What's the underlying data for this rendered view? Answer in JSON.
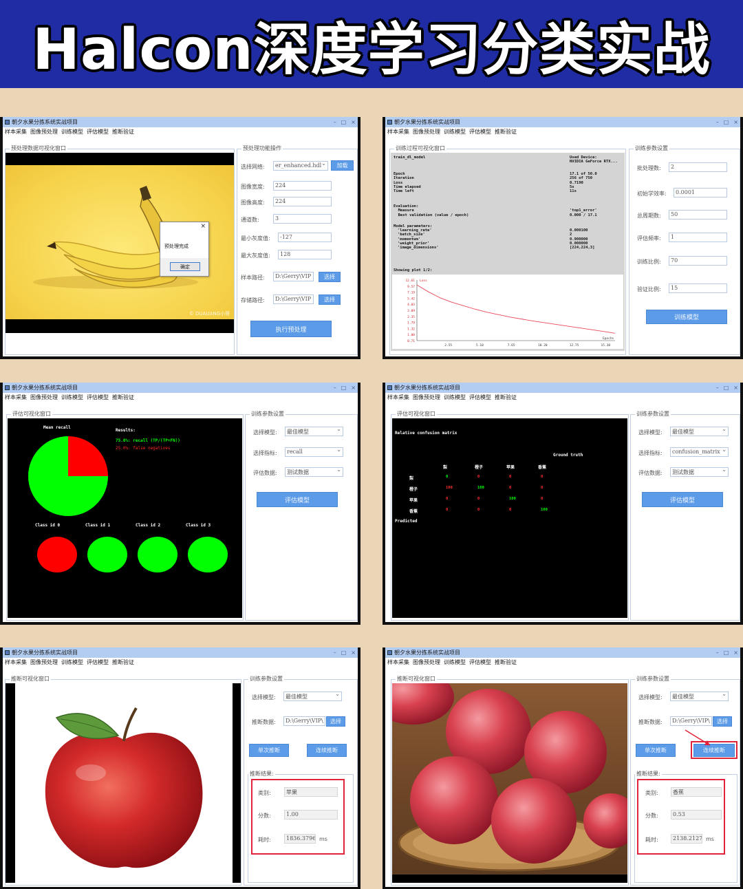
{
  "banner_title": "Halcon深度学习分类实战",
  "window": {
    "title": "朝夕水果分拣系统实战项目",
    "menu": [
      "样本采集",
      "图像预处理",
      "训练模型",
      "评估模型",
      "推断验证"
    ],
    "controls": [
      "–",
      "□",
      "×"
    ]
  },
  "preprocess": {
    "viz_label": "预处理数据可视化窗口",
    "ops_label": "预处理功能操作",
    "network_label": "选择网络:",
    "network_value": "er_enhanced.hdl",
    "load_button": "加载",
    "width_label": "图像宽度:",
    "width_value": "224",
    "height_label": "图像高度:",
    "height_value": "224",
    "channels_label": "通道数:",
    "channels_value": "3",
    "min_gray_label": "最小灰度值:",
    "min_gray_value": "-127",
    "max_gray_label": "最大灰度值:",
    "max_gray_value": "128",
    "sample_path_label": "样本路径:",
    "sample_path_value": "D:\\Gerry\\VIP",
    "store_path_label": "存储路径:",
    "store_path_value": "D:\\Gerry\\VIP",
    "select_button": "选择",
    "run_button": "执行预处理",
    "dialog_message": "预处理完成",
    "dialog_ok": "确定",
    "dialog_close": "×",
    "watermark": "© DUAUANG小哥"
  },
  "training": {
    "viz_label": "训练过程可视化窗口",
    "params_label": "训练参数设置",
    "header_left": "train_dl_model",
    "header_right": [
      "Used Device:",
      "NVIDIA GeForce RTX..."
    ],
    "stats_labels": [
      "Epoch",
      "Iteration",
      "Loss",
      "Time elapsed",
      "Time left"
    ],
    "stats_values": [
      "17.1 of 50.0",
      "256 of 750",
      "0.7190",
      "5s",
      "11s"
    ],
    "eval_labels": [
      "Evaluation:",
      "  Measure",
      "  Best validation (value / epoch)"
    ],
    "eval_values": [
      "",
      "'top1_error'",
      "0.000 / 17.1"
    ],
    "model_params_label": "Model parameters:",
    "model_params": [
      "'learning_rate'",
      "'batch_size'",
      "'momentum'",
      "'weight_prior'",
      "'image_dimensions'"
    ],
    "model_values": [
      "0.000100",
      "2",
      "0.900000",
      "0.000000",
      "[224,224,3]"
    ],
    "plot_title": "Showing plot 1/2:",
    "plot_series": "Loss",
    "plot_xlabel": "Epochs",
    "batch_label": "批处理数:",
    "batch_value": "2",
    "lr_label": "初始学效率:",
    "lr_value": "0.0001",
    "epochs_label": "总周期数:",
    "epochs_value": "50",
    "eval_freq_label": "评估频率:",
    "eval_freq_value": "1",
    "train_ratio_label": "训练比例:",
    "train_ratio_value": "70",
    "val_ratio_label": "验证比例:",
    "val_ratio_value": "15",
    "train_button": "训练模型"
  },
  "chart_data": {
    "type": "line",
    "series": [
      {
        "name": "Loss",
        "x": [
          0,
          1,
          2,
          3,
          4,
          5,
          6,
          8,
          10,
          12,
          14,
          16,
          17.1
        ],
        "values": [
          12.0,
          10.6,
          9.4,
          8.5,
          7.8,
          7.1,
          6.5,
          5.5,
          4.7,
          4.0,
          3.3,
          2.6,
          2.2
        ]
      }
    ],
    "ylim": [
      0.71,
      13.0
    ],
    "xlim": [
      0,
      17.1
    ],
    "y_ticks": [
      "12.61",
      "9.57",
      "7.19",
      "5.42",
      "4.03",
      "3.09",
      "2.35",
      "1.79",
      "1.32",
      "1.00",
      "0.71"
    ],
    "x_ticks": [
      "2.55",
      "5.10",
      "7.65",
      "10.20",
      "12.75",
      "15.30"
    ],
    "xlabel": "Epochs",
    "grid": false
  },
  "evaluation": {
    "viz_label": "评估可视化窗口",
    "params_label": "训练参数设置",
    "model_label": "选择模型:",
    "model_value": "最佳模型",
    "metric_label": "选择指标:",
    "data_label": "评估数据:",
    "data_value": "测试数据",
    "eval_button": "评估模型",
    "recall": {
      "metric_value": "recall",
      "title": "Mean recall",
      "results_label": "Results:",
      "results_green": "75.0%: recall (TP/(TP+FN))",
      "results_red": "25.0%: false negatives",
      "pie": [
        {
          "label": "recall",
          "value": 75,
          "color": "#00ff00"
        },
        {
          "label": "false negatives",
          "value": 25,
          "color": "#ff0000"
        }
      ],
      "classes": [
        {
          "label": "Class id 0",
          "color": "#ff0000"
        },
        {
          "label": "Class id 1",
          "color": "#00ff00"
        },
        {
          "label": "Class id 2",
          "color": "#00ff00"
        },
        {
          "label": "Class id 3",
          "color": "#00ff00"
        }
      ]
    },
    "confusion": {
      "metric_value": "confusion_matrix",
      "title": "Relative confusion matrix",
      "ground_truth": "Ground truth",
      "predicted": "Predicted",
      "classes": [
        "梨",
        "橙子",
        "苹果",
        "香蕉"
      ],
      "matrix": [
        [
          0,
          0,
          0,
          0
        ],
        [
          100,
          100,
          0,
          0
        ],
        [
          0,
          0,
          100,
          0
        ],
        [
          0,
          0,
          0,
          100
        ]
      ]
    }
  },
  "inference": {
    "viz_label": "推断可视化窗口",
    "params_label": "训练参数设置",
    "model_label": "选择模型:",
    "model_value": "最佳模型",
    "data_label": "推断数据:",
    "data_value": "D:\\Gerry\\VIP\\",
    "select_button": "选择",
    "single_button": "单次推断",
    "continuous_button": "连续推断",
    "result_label": "推断结果:",
    "class_label": "类别:",
    "score_label": "分数:",
    "time_label": "耗时:",
    "time_unit": "ms",
    "left": {
      "class_value": "苹果",
      "score_value": "1.00",
      "time_value": "1836.3796"
    },
    "right": {
      "class_value": "香蕉",
      "score_value": "0.53",
      "time_value": "2138.2127"
    }
  }
}
